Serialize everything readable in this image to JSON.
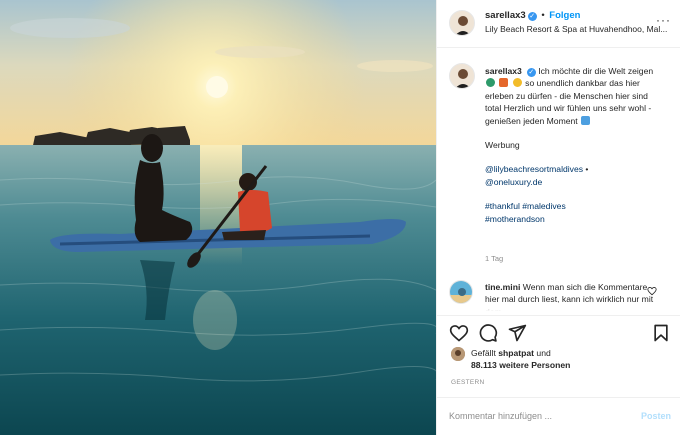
{
  "post": {
    "image_alt": "Mother and son on a stand-up paddle board at sunset",
    "colors": {
      "sky_top": "#aac8d5",
      "sun": "#fff4c2",
      "water_deep": "#0d4b55",
      "board": "#3c6ea6"
    }
  },
  "header": {
    "username": "sarellax3",
    "verified": "✓",
    "separator": "•",
    "follow_label": "Folgen",
    "location": "Lily Beach Resort & Spa at Huvahendhoo, Mal...",
    "more_icon": "more-horizontal-icon",
    "more_label": "···"
  },
  "caption": {
    "username": "sarellax3",
    "text_1": "Ich möchte dir die Welt zeigen",
    "text_2": "so unendlich dankbar das hier erleben zu dürfen - die Menschen hier sind total Herzlich und wir fühlen uns sehr wohl - genießen jeden Moment",
    "ad_label": "Werbung",
    "mention_1": "@lilybeachresortmaldives",
    "mention_sep": " •",
    "mention_2": "@oneluxury.de",
    "hashtag_1": "#thankful",
    "hashtag_2": "#maledives",
    "hashtag_3": "#motherandson",
    "time_ago": "1 Tag"
  },
  "comment": {
    "username": "tine.mini",
    "text": "Wenn man sich die Kommentare hier mal durch liest, kann ich wirklich nur mit dem"
  },
  "actions": {
    "like_icon": "heart-icon",
    "comment_icon": "comment-icon",
    "share_icon": "send-icon",
    "save_icon": "bookmark-icon"
  },
  "likes": {
    "prefix": "Gefällt ",
    "liker": "shpatpat",
    "middle": " und",
    "count": "88.113 weitere Personen"
  },
  "date": "GESTERN",
  "add_comment": {
    "placeholder": "Kommentar hinzufügen ...",
    "post_label": "Posten"
  }
}
